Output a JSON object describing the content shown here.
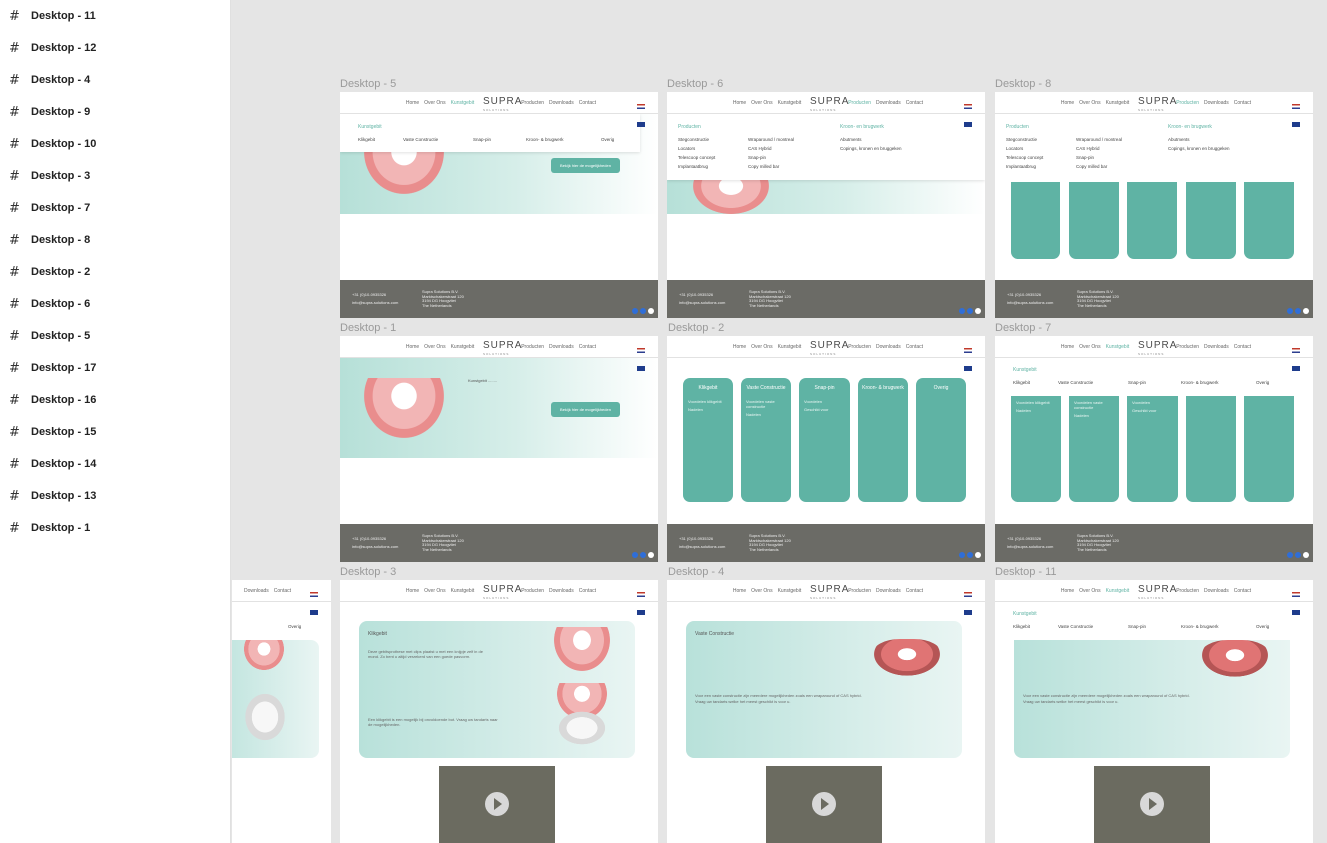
{
  "layers": [
    "Desktop - 11",
    "Desktop - 12",
    "Desktop - 4",
    "Desktop - 9",
    "Desktop - 10",
    "Desktop - 3",
    "Desktop - 7",
    "Desktop - 8",
    "Desktop - 2",
    "Desktop - 6",
    "Desktop - 5",
    "Desktop - 17",
    "Desktop - 16",
    "Desktop - 15",
    "Desktop - 14",
    "Desktop - 13",
    "Desktop - 1"
  ],
  "frame_labels": {
    "f5": "Desktop - 5",
    "f6": "Desktop - 6",
    "f8": "Desktop - 8",
    "f1": "Desktop - 1",
    "f2": "Desktop - 2",
    "f7": "Desktop - 7",
    "f3": "Desktop - 3",
    "f4": "Desktop - 4",
    "f11": "Desktop - 11"
  },
  "nav": {
    "home": "Home",
    "over": "Over Ons",
    "kunst": "Kunstgebit",
    "producten": "Producten",
    "downloads": "Downloads",
    "contact": "Contact",
    "logo": "SUPRA",
    "logo_sub": "SOLUTIONS"
  },
  "footer": {
    "phone": "+31 (0)10-0935326",
    "email": "info@supra-solutions.com",
    "company": "Supra Solutions B.V.",
    "street": "Marktschakerstraat 120",
    "city": "3194 DG Hoogvliet",
    "country": "The Netherlands"
  },
  "hero": {
    "button": "Bekijk hier de mogelijkheden",
    "kunst_small": "Kunstgebit ........"
  },
  "kunst_menu": {
    "title": "Kunstgebit",
    "items": [
      "Klikgebit",
      "Vaste Constructie",
      "Snap-pin",
      "Kroon- & brugwerk",
      "Overig"
    ]
  },
  "product_menu": {
    "head_left": "Producten",
    "head_right": "Kroon- en brugwerk",
    "col1": [
      "Stegconstructie",
      "Locators",
      "Telescoop concept",
      "Implantaatbrug"
    ],
    "col2": [
      "Wraparound / montreal",
      "CAS Hybrid",
      "Snap-pin",
      "Copy milled bar"
    ],
    "col3_6": [
      "Abutments",
      "Copings, kronen en bruggeken"
    ],
    "col3_8": [
      "Abutments",
      "Copings, kronen en bruggeken"
    ]
  },
  "cards": {
    "klik": "Klikgebit",
    "vaste": "Vaste Constructie",
    "snap": "Snap-pin",
    "kroon": "Kroon- & brugwerk",
    "overig": "Overig",
    "klik_sub": "Voordelen klikgebit",
    "klik_sub2": "Nadelen",
    "vaste_sub": "Voordelen vaste constructie",
    "vaste_sub2": "Nadelen",
    "snap_sub": "Voordelen",
    "snap_sub2": "Geschikt voor"
  },
  "d3": {
    "title": "Klikgebit",
    "p1": "Deze gebitsprothese met clips plaatst u met een knijpje zelf in de mond. Zo bent u altijd verzekerd van een goede pasvorm.",
    "p2": "Een klikgebit is een mogelijk bij onvoldoende bot. Vraag uw tandarts naar de mogelijkheden."
  },
  "d4": {
    "title": "Vaste Constructie",
    "p1": "Voor een vaste constructie zijn meerdere mogelijkheden zoals een wraparound of CAS hybrid.",
    "p2": "Vraag uw tandarts welke het meest geschikt is voor u."
  },
  "d11": {
    "p1": "Voor een vaste constructie zijn meerdere mogelijkheden zoals een wraparound of CAS hybrid.",
    "p2": "Vraag uw tandarts welke het meest geschikt is voor u."
  },
  "partial": {
    "downloads": "Downloads",
    "contact": "Contact",
    "overig": "Overig"
  },
  "colors": {
    "accent": "#5fb3a4",
    "footer": "#6b6b66",
    "canvas": "#e5e5e5"
  }
}
